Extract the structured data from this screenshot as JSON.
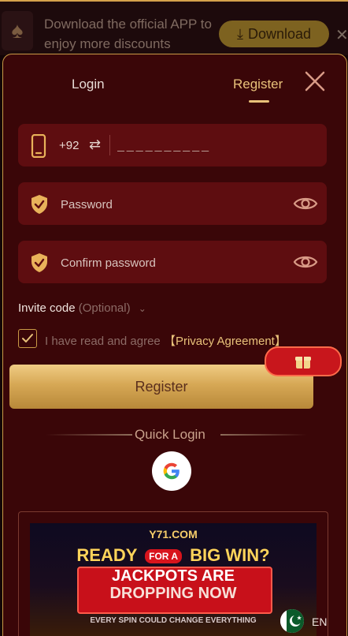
{
  "app_bar": {
    "promo_text": "Download the official APP to enjoy more discounts",
    "download_label": "Download"
  },
  "tabs": {
    "login": "Login",
    "register": "Register",
    "active": "register"
  },
  "phone": {
    "country_code": "+92",
    "placeholder": "__________"
  },
  "password": {
    "placeholder": "Password"
  },
  "confirm_password": {
    "placeholder": "Confirm password"
  },
  "invite": {
    "label": "Invite code",
    "optional": "(Optional)"
  },
  "agreement": {
    "text": "I have read and agree",
    "link": "【Privacy Agreement】",
    "checked": true
  },
  "register_button": "Register",
  "quick_login": {
    "title": "Quick Login",
    "provider_icon": "google-icon"
  },
  "banner": {
    "logo": "Y71.COM",
    "line1_a": "READY",
    "line1_b": "FOR A",
    "line1_c": "BIG WIN?",
    "line2": "JACKPOTS ARE",
    "line3": "DROPPING NOW",
    "line4": "EVERY SPIN COULD CHANGE EVERYTHING"
  },
  "language": {
    "code": "EN",
    "flag_icon": "pakistan-flag-icon"
  },
  "colors": {
    "accent_gold": "#e9c27a",
    "panel": "#3a0608",
    "field": "#5e0d10",
    "button_gold": "#d6a855"
  }
}
